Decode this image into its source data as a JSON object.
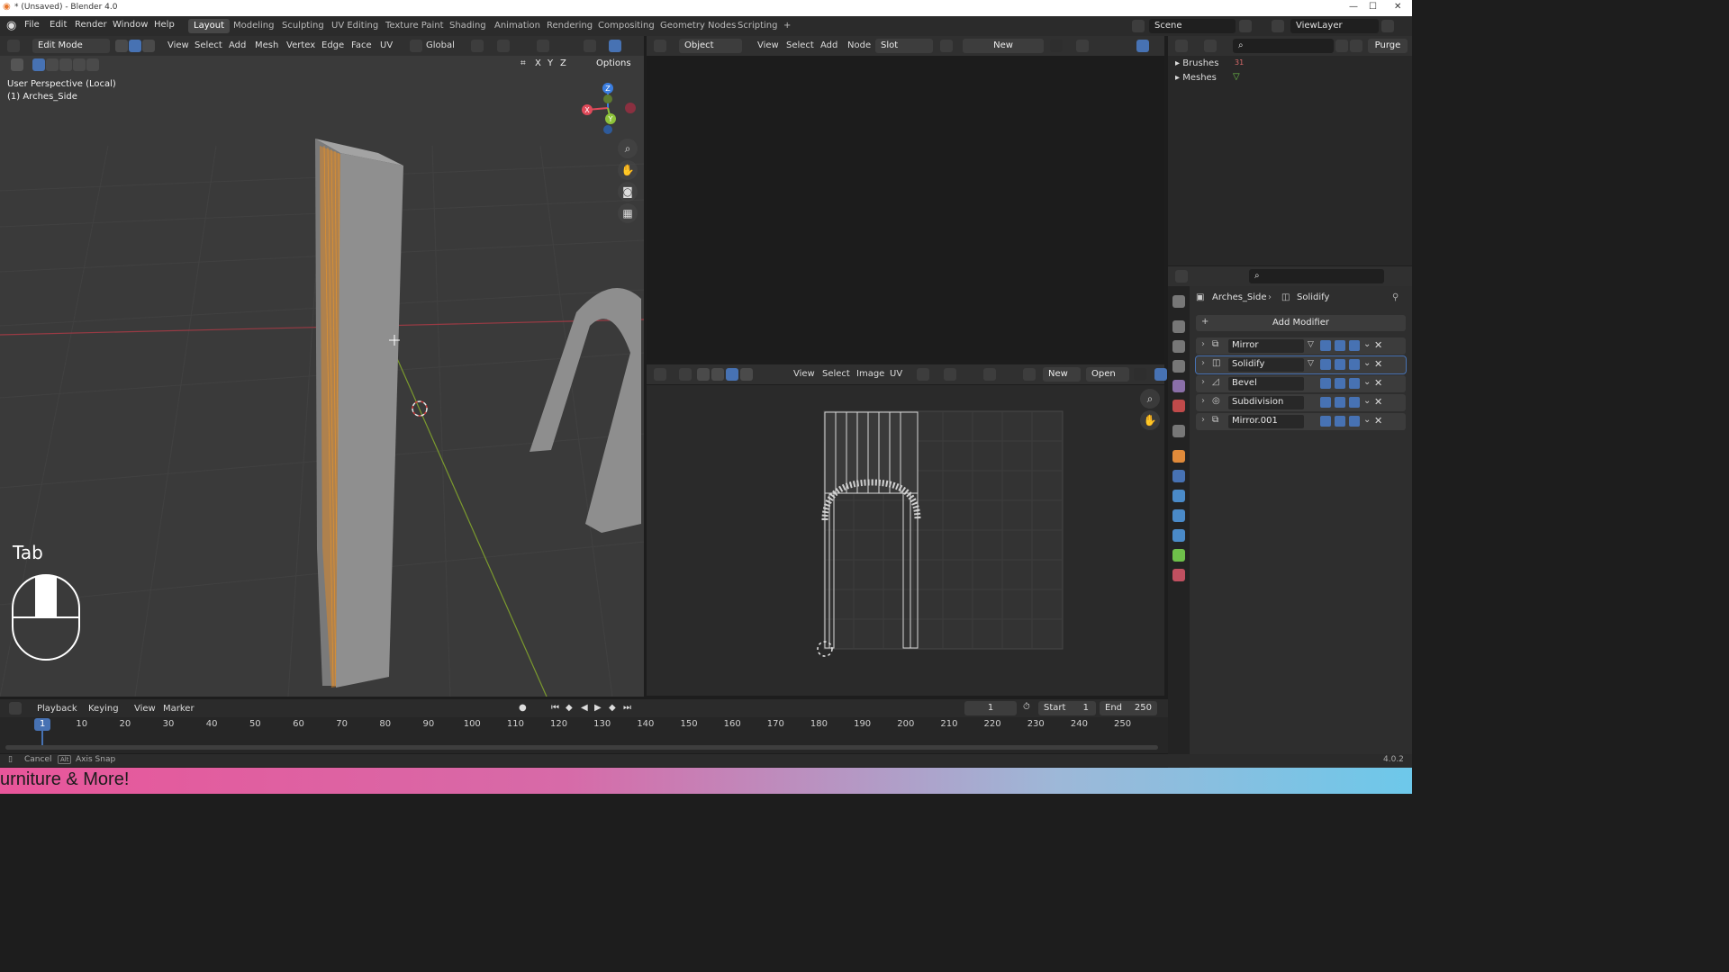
{
  "window": {
    "title": "* (Unsaved) - Blender 4.0"
  },
  "menu": {
    "items": [
      "File",
      "Edit",
      "Render",
      "Window",
      "Help"
    ]
  },
  "workspaces": {
    "tabs": [
      "Layout",
      "Modeling",
      "Sculpting",
      "UV Editing",
      "Texture Paint",
      "Shading",
      "Animation",
      "Rendering",
      "Compositing",
      "Geometry Nodes",
      "Scripting"
    ],
    "active": "Layout",
    "add": "+"
  },
  "scene": {
    "label": "Scene",
    "view_layer": "ViewLayer"
  },
  "viewport_header": {
    "mode": "Edit Mode",
    "menus": [
      "View",
      "Select",
      "Add",
      "Mesh",
      "Vertex",
      "Edge",
      "Face",
      "UV"
    ],
    "transform_orientation": "Global",
    "axes": [
      "X",
      "Y",
      "Z"
    ],
    "options": "Options"
  },
  "viewport": {
    "perspective": "User Perspective (Local)",
    "object": "(1) Arches_Side",
    "key_overlay": "Tab",
    "gizmo": {
      "z": "Z",
      "y": "Y",
      "x": "X"
    }
  },
  "shader_header": {
    "object_mode": "Object",
    "menus": [
      "View",
      "Select",
      "Add",
      "Node"
    ],
    "slot": "Slot",
    "new": "New"
  },
  "uv_header": {
    "menus": [
      "View",
      "Select",
      "Image",
      "UV"
    ],
    "new": "New",
    "open": "Open"
  },
  "outliner": {
    "items": [
      {
        "label": "Brushes",
        "count": "31"
      },
      {
        "label": "Meshes",
        "count": ""
      }
    ],
    "purge": "Purge"
  },
  "properties": {
    "breadcrumb": [
      "Arches_Side",
      "Solidify"
    ],
    "add_modifier": "Add Modifier",
    "modifiers": [
      {
        "name": "Mirror",
        "selected": false
      },
      {
        "name": "Solidify",
        "selected": true
      },
      {
        "name": "Bevel",
        "selected": false
      },
      {
        "name": "Subdivision",
        "selected": false
      },
      {
        "name": "Mirror.001",
        "selected": false
      }
    ]
  },
  "timeline": {
    "menus": [
      "Playback",
      "Keying",
      "View",
      "Marker"
    ],
    "current_frame": "1",
    "start_label": "Start",
    "start": "1",
    "end_label": "End",
    "end": "250",
    "ticks": [
      "1",
      "10",
      "20",
      "30",
      "40",
      "50",
      "60",
      "70",
      "80",
      "90",
      "100",
      "110",
      "120",
      "130",
      "140",
      "150",
      "160",
      "170",
      "180",
      "190",
      "200",
      "210",
      "220",
      "230",
      "240",
      "250"
    ]
  },
  "statusbar": {
    "cancel": "Cancel",
    "alt_key": "Alt",
    "axis_snap": "Axis Snap",
    "version": "4.0.2"
  },
  "banner": {
    "text": "urniture & More!"
  },
  "colors": {
    "accent": "#4772b3",
    "selection": "#e8952c",
    "x_axis": "#e04a5a",
    "y_axis": "#8ec33a",
    "z_axis": "#3a7de0"
  }
}
